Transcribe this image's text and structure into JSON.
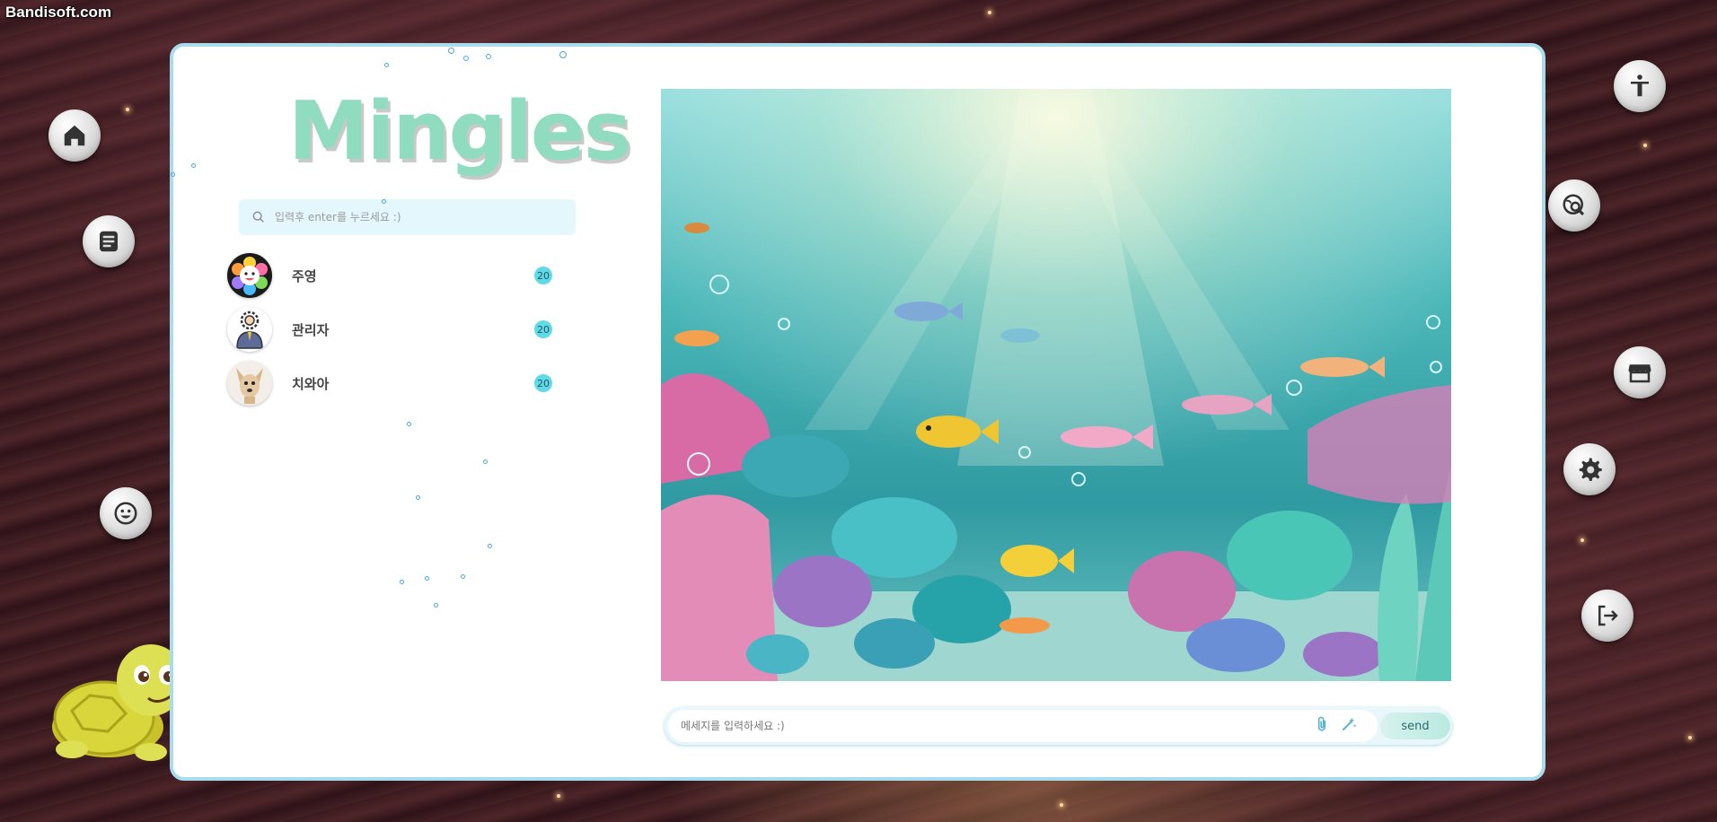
{
  "watermark": "Bandisoft.com",
  "app": {
    "logo": "Mingles"
  },
  "search": {
    "placeholder": "입력후 enter를 누르세요 :)"
  },
  "friends": [
    {
      "name": "주영",
      "count": "20"
    },
    {
      "name": "관리자",
      "count": "20"
    },
    {
      "name": "치와아",
      "count": "20"
    }
  ],
  "message": {
    "placeholder": "메세지를 입력하세요 :)",
    "send_label": "send"
  },
  "left_nav": [
    "home-icon",
    "document-icon",
    "smiley-icon"
  ],
  "right_nav": [
    "accessibility-icon",
    "search-globe-icon",
    "store-icon",
    "gear-icon",
    "logout-icon"
  ],
  "colors": {
    "panel_border": "#a7dcef",
    "logo": "#8fdcc0",
    "badge": "#5fdbe8",
    "search_bg": "#e3f7fd"
  }
}
